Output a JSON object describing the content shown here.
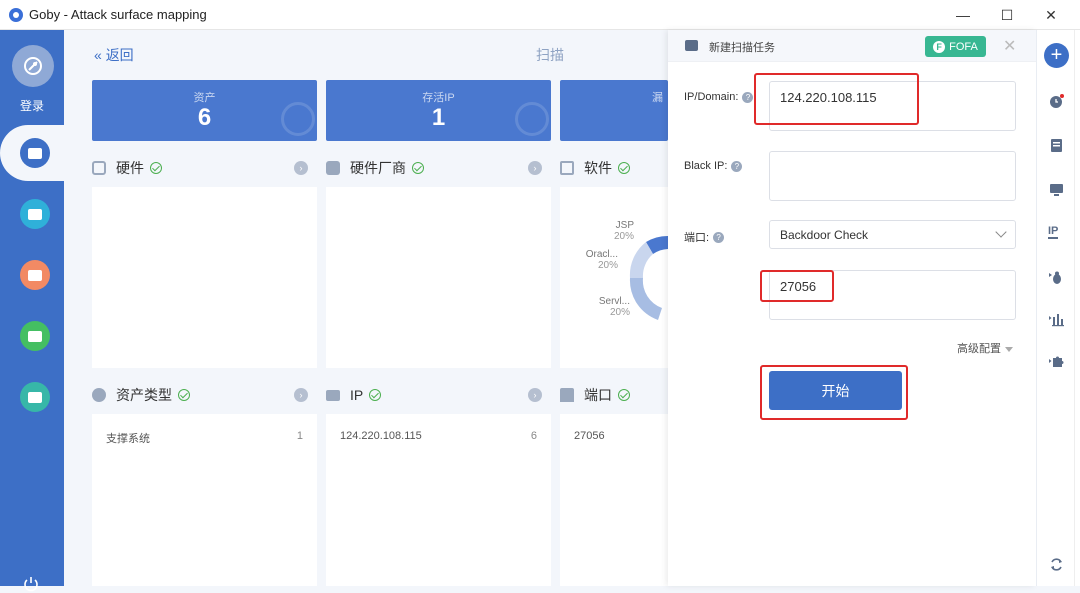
{
  "window": {
    "title": "Goby - Attack surface mapping",
    "controls": {
      "minimize": "—",
      "maximize": "☐",
      "close": "✕"
    }
  },
  "sidebar": {
    "login_label": "登录",
    "icons": [
      "avatar-icon",
      "scan-icon",
      "asset-list-icon",
      "report-icon",
      "chart-icon",
      "plugin-icon",
      "power-icon"
    ],
    "colors": {
      "bar": "#3d6fc6",
      "list": "#2fb0d9",
      "report": "#f28a64",
      "chart": "#44bf62",
      "plugin": "#37b7a8"
    }
  },
  "header": {
    "back_label": "返回",
    "page_title": "扫描"
  },
  "stats": [
    {
      "label": "资产",
      "value": "6"
    },
    {
      "label": "存活IP",
      "value": "1"
    },
    {
      "label": "漏",
      "value": ""
    }
  ],
  "sections": {
    "hardware": {
      "title": "硬件"
    },
    "vendor": {
      "title": "硬件厂商"
    },
    "software": {
      "title": "软件"
    },
    "asset_type": {
      "title": "资产类型",
      "rows": [
        {
          "name": "支撑系统",
          "count": "1"
        }
      ]
    },
    "ip": {
      "title": "IP",
      "rows": [
        {
          "name": "124.220.108.115",
          "count": "6"
        }
      ]
    },
    "port": {
      "title": "端口",
      "rows": [
        {
          "name": "27056",
          "count": ""
        }
      ]
    }
  },
  "software_donut": {
    "slices": [
      {
        "label": "JSP",
        "pct": "20%"
      },
      {
        "label": "Oracl...",
        "pct": "20%"
      },
      {
        "label": "Servl...",
        "pct": "20%"
      }
    ]
  },
  "scan_modal": {
    "title": "新建扫描任务",
    "fofa_label": "FOFA",
    "close": "✕",
    "ip_label": "IP/Domain:",
    "ip_value": "124.220.108.115",
    "black_ip_label": "Black IP:",
    "black_ip_value": "",
    "port_label": "端口:",
    "port_select": "Backdoor Check",
    "port_value": "27056",
    "advanced_label": "高级配置",
    "start_label": "开始"
  },
  "rightbar": {
    "plus": "+",
    "ip_label": "IP"
  }
}
